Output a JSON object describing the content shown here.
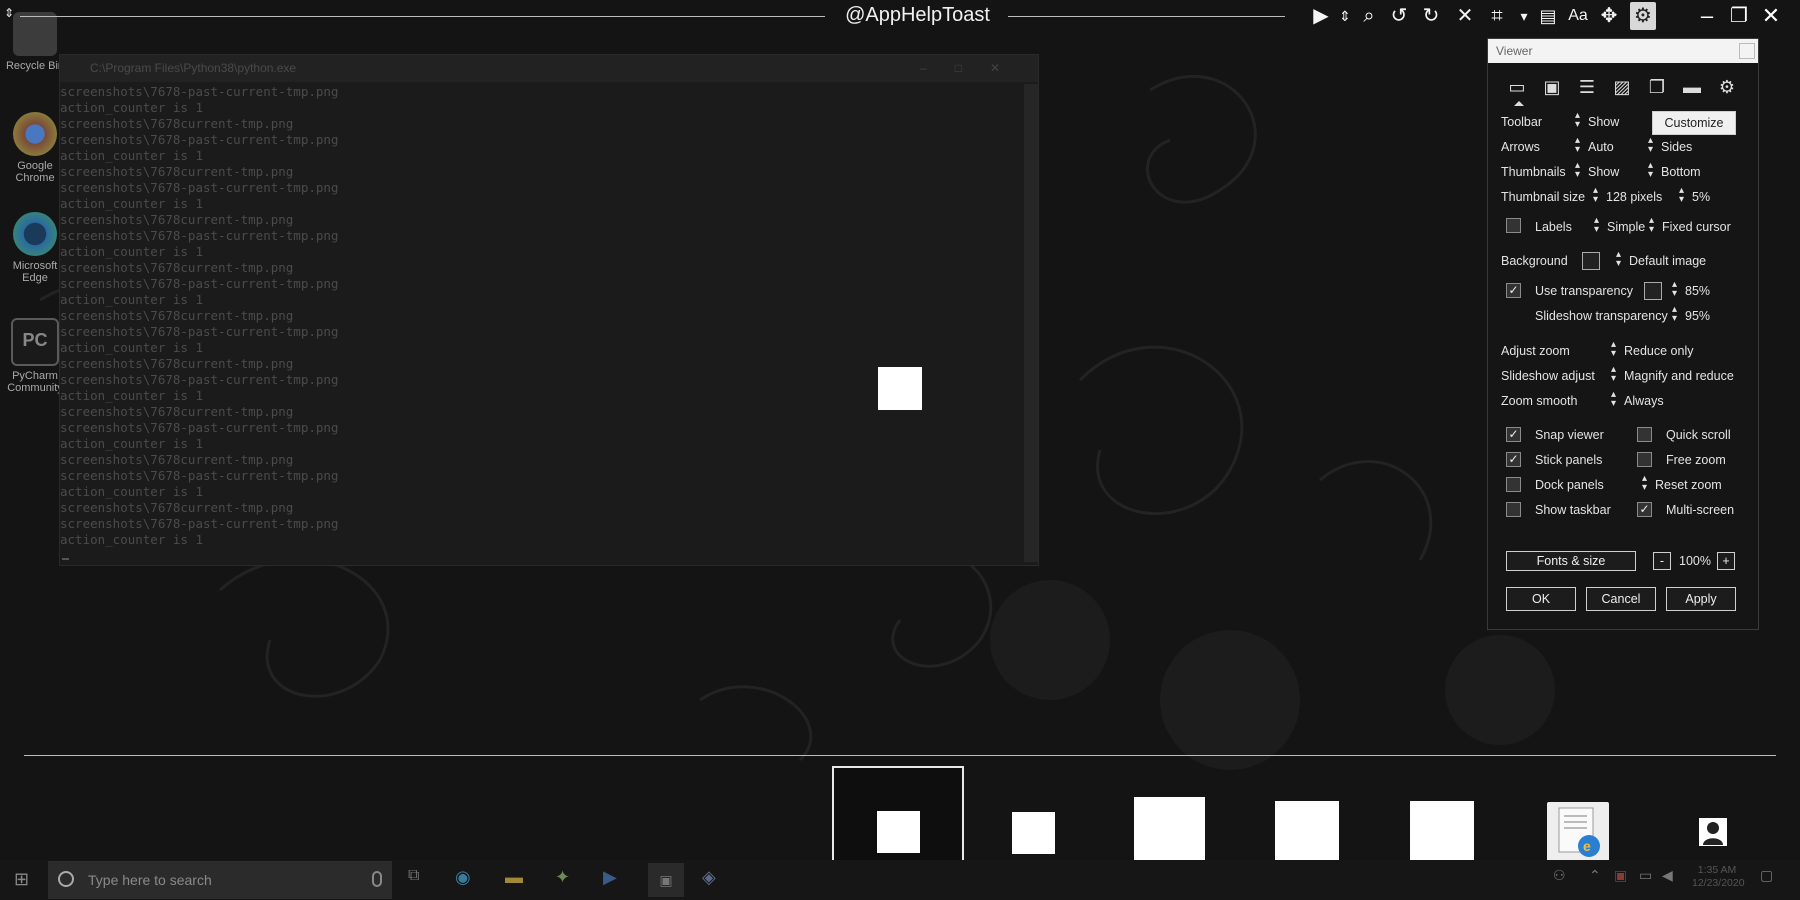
{
  "header": {
    "title": "@AppHelpToast"
  },
  "toolbar": {
    "icons": [
      "play-icon",
      "updown-icon",
      "search-icon",
      "rotate-left-icon",
      "rotate-right-icon",
      "close-icon",
      "crop-icon",
      "dropdown-icon",
      "document-icon",
      "font-icon",
      "move-icon",
      "settings-icon"
    ],
    "window_controls": [
      "minimize-icon",
      "restore-icon",
      "close-window-icon"
    ]
  },
  "desktop": {
    "icons": [
      {
        "label": "Recycle Bin"
      },
      {
        "label": "Google Chrome"
      },
      {
        "label": "Microsoft Edge"
      },
      {
        "label": "PyCharm Community"
      }
    ]
  },
  "console": {
    "title": "C:\\Program Files\\Python38\\python.exe",
    "lines": [
      "screenshots\\7678-past-current-tmp.png",
      "action_counter is 1",
      "screenshots\\7678current-tmp.png",
      "screenshots\\7678-past-current-tmp.png",
      "action_counter is 1",
      "screenshots\\7678current-tmp.png",
      "screenshots\\7678-past-current-tmp.png",
      "action_counter is 1",
      "screenshots\\7678current-tmp.png",
      "screenshots\\7678-past-current-tmp.png",
      "action_counter is 1",
      "screenshots\\7678current-tmp.png",
      "screenshots\\7678-past-current-tmp.png",
      "action_counter is 1",
      "screenshots\\7678current-tmp.png",
      "screenshots\\7678-past-current-tmp.png",
      "action_counter is 1",
      "screenshots\\7678current-tmp.png",
      "screenshots\\7678-past-current-tmp.png",
      "action_counter is 1",
      "screenshots\\7678current-tmp.png",
      "screenshots\\7678-past-current-tmp.png",
      "action_counter is 1",
      "screenshots\\7678current-tmp.png",
      "screenshots\\7678-past-current-tmp.png",
      "action_counter is 1",
      "screenshots\\7678current-tmp.png",
      "screenshots\\7678-past-current-tmp.png",
      "action_counter is 1"
    ]
  },
  "panel": {
    "title": "Viewer",
    "rows": {
      "toolbar_label": "Toolbar",
      "toolbar_value": "Show",
      "customize": "Customize",
      "arrows_label": "Arrows",
      "arrows_value": "Auto",
      "arrows_pos": "Sides",
      "thumbs_label": "Thumbnails",
      "thumbs_value": "Show",
      "thumbs_pos": "Bottom",
      "thumbsize_label": "Thumbnail size",
      "thumbsize_value": "128 pixels",
      "thumbsize_pct": "5%",
      "labels_label": "Labels",
      "labels_value": "Simple",
      "fixed_cursor": "Fixed cursor",
      "background_label": "Background",
      "background_value": "Default image",
      "use_transparency": "Use transparency",
      "transparency_value": "85%",
      "slideshow_transparency": "Slideshow transparency",
      "slideshow_transparency_value": "95%",
      "adjust_zoom_label": "Adjust zoom",
      "adjust_zoom_value": "Reduce only",
      "slideshow_adjust_label": "Slideshow adjust",
      "slideshow_adjust_value": "Magnify and reduce",
      "zoom_smooth_label": "Zoom smooth",
      "zoom_smooth_value": "Always",
      "snap_viewer": "Snap viewer",
      "quick_scroll": "Quick scroll",
      "stick_panels": "Stick panels",
      "free_zoom": "Free zoom",
      "dock_panels": "Dock panels",
      "reset_zoom": "Reset zoom",
      "show_taskbar": "Show taskbar",
      "multi_screen": "Multi-screen",
      "fonts_size": "Fonts & size",
      "minus": "-",
      "zoom_pct": "100%",
      "plus": "+"
    },
    "checks": {
      "labels": "",
      "use_transparency": "✓",
      "snap_viewer": "✓",
      "quick_scroll": "",
      "stick_panels": "✓",
      "free_zoom": "",
      "dock_panels": "",
      "show_taskbar": "",
      "multi_screen": "✓"
    },
    "buttons": {
      "ok": "OK",
      "cancel": "Cancel",
      "apply": "Apply"
    }
  },
  "taskbar": {
    "search_placeholder": "Type here to search",
    "time": "1:35 AM",
    "date": "12/23/2020"
  },
  "colors": {
    "accent": "#ffffff",
    "panel_bg": "#151515"
  }
}
